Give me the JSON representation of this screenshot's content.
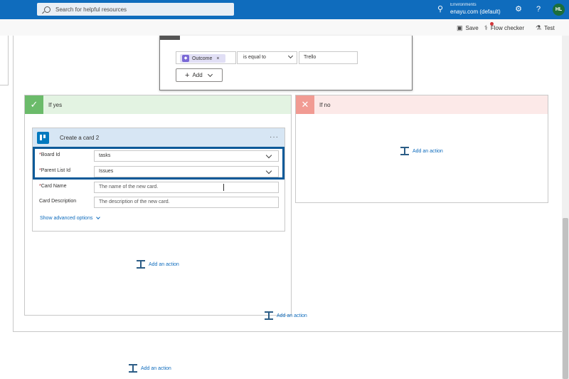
{
  "header": {
    "search_placeholder": "Search for helpful resources",
    "env_label": "Environments",
    "env_name": "enayu.com (default)",
    "avatar_initials": "HL"
  },
  "commandbar": {
    "save": "Save",
    "flow_checker": "Flow checker",
    "test": "Test"
  },
  "condition": {
    "token": "Outcome",
    "token_remove": "×",
    "operator": "is equal to",
    "value": "Trello",
    "add_label": "Add"
  },
  "branches": {
    "yes_label": "If yes",
    "no_label": "If no"
  },
  "card": {
    "title": "Create a card 2",
    "menu": "···",
    "fields": {
      "board_id_label": "Board Id",
      "board_id_value": "tasks",
      "parent_list_label": "Parent List Id",
      "parent_list_value": "Issues",
      "card_name_label": "Card Name",
      "card_name_placeholder": "The name of the new card.",
      "card_desc_label": "Card Description",
      "card_desc_placeholder": "The description of the new card."
    },
    "required_mark": "*",
    "advanced": "Show advanced options"
  },
  "actions": {
    "add_action": "Add an action"
  },
  "colors": {
    "header_blue": "#0f6cbd",
    "yes_green": "#6bbb6a",
    "no_red": "#f19b93",
    "highlight_border": "#0d5a99",
    "trello_blue": "#0079bf"
  }
}
